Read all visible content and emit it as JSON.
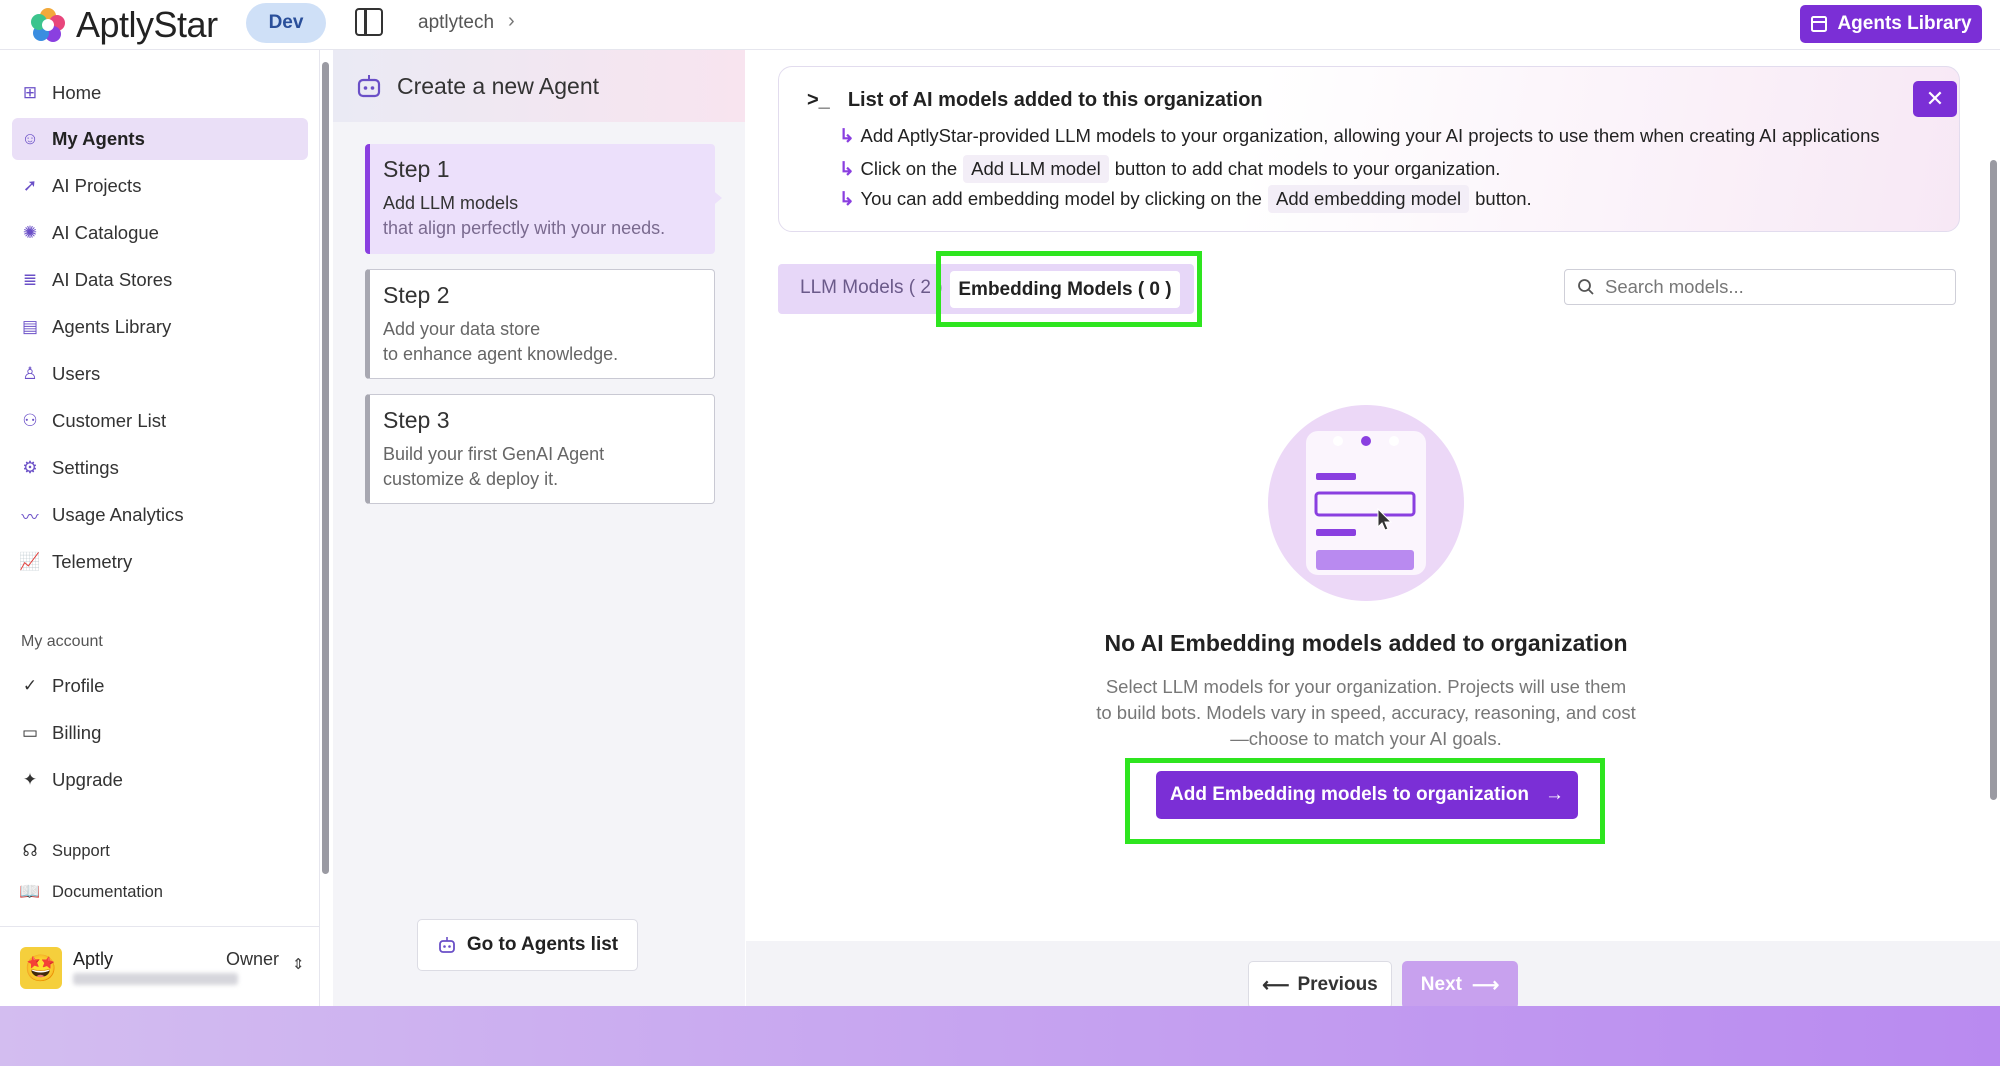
{
  "app": {
    "name": "AptlyStar",
    "env": "Dev"
  },
  "header": {
    "breadcrumb": "aptlytech",
    "library_button": "Agents Library"
  },
  "sidebar": {
    "items": [
      {
        "label": "Home",
        "icon": "home-icon"
      },
      {
        "label": "My Agents",
        "icon": "robot-icon",
        "active": true
      },
      {
        "label": "AI Projects",
        "icon": "rocket-icon"
      },
      {
        "label": "AI Catalogue",
        "icon": "brain-icon"
      },
      {
        "label": "AI Data Stores",
        "icon": "database-icon"
      },
      {
        "label": "Agents Library",
        "icon": "library-icon"
      },
      {
        "label": "Users",
        "icon": "user-icon"
      },
      {
        "label": "Customer List",
        "icon": "users-icon"
      },
      {
        "label": "Settings",
        "icon": "gear-icon"
      },
      {
        "label": "Usage Analytics",
        "icon": "trend-icon"
      },
      {
        "label": "Telemetry",
        "icon": "chart-icon"
      }
    ],
    "account_label": "My account",
    "account_items": [
      {
        "label": "Profile",
        "icon": "check-circle-icon"
      },
      {
        "label": "Billing",
        "icon": "card-icon"
      },
      {
        "label": "Upgrade",
        "icon": "sparkle-icon"
      }
    ],
    "support_items": [
      {
        "label": "Support",
        "icon": "headset-icon"
      },
      {
        "label": "Documentation",
        "icon": "book-icon"
      }
    ],
    "user": {
      "name": "Aptly",
      "role": "Owner"
    }
  },
  "steps_panel": {
    "title": "Create a new Agent",
    "steps": [
      {
        "title": "Step 1",
        "line1": "Add LLM models",
        "line2": "that align perfectly with your needs."
      },
      {
        "title": "Step 2",
        "line1": "Add your data store",
        "line2": "to enhance agent knowledge."
      },
      {
        "title": "Step 3",
        "line1": "Build your first GenAI Agent",
        "line2": "customize & deploy it."
      }
    ],
    "go_button": "Go to Agents list"
  },
  "info": {
    "title": "List of AI models added to this organization",
    "line1": "Add AptlyStar-provided LLM models to your organization, allowing your AI projects to use them when creating AI applications",
    "line2_pre": "Click on the",
    "line2_chip": "Add LLM model",
    "line2_post": "button to add chat models to your organization.",
    "line3_pre": "You can add embedding model by clicking on the",
    "line3_chip": "Add embedding model",
    "line3_post": "button."
  },
  "tabs": {
    "llm": "LLM Models ( 2 )",
    "embedding": "Embedding Models ( 0 )"
  },
  "search": {
    "placeholder": "Search models..."
  },
  "empty_state": {
    "title": "No AI Embedding models added to organization",
    "description": "Select LLM models for your organization. Projects will use them to build bots. Models vary in speed, accuracy, reasoning, and cost—choose to match your AI goals.",
    "button": "Add Embedding models to organization"
  },
  "footer": {
    "previous": "Previous",
    "next": "Next"
  },
  "colors": {
    "accent": "#7b2fd6",
    "highlight": "#2ee51f",
    "active_bg": "#eadff7"
  }
}
